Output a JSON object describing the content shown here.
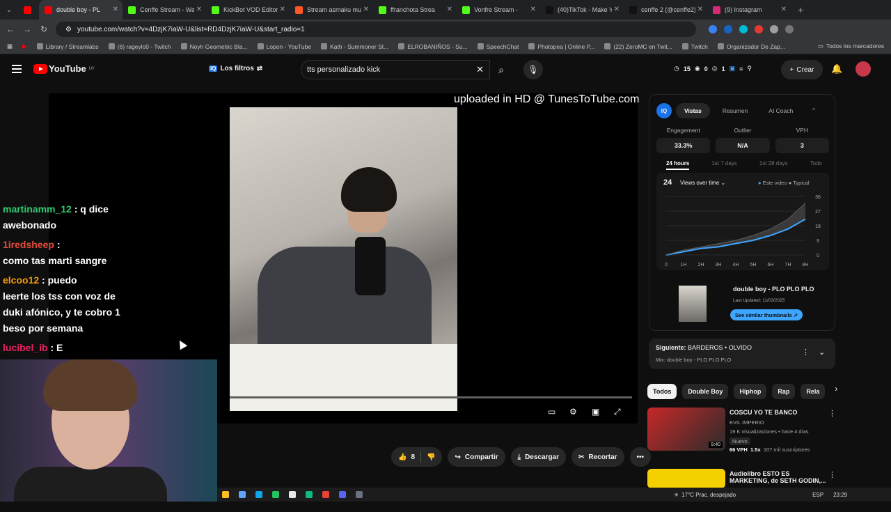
{
  "browser": {
    "tabs": [
      {
        "title": "",
        "color": "#ff0000"
      },
      {
        "title": "double boy - PL",
        "color": "#ff0000",
        "active": true
      },
      {
        "title": "Cenffe Stream - Wa",
        "color": "#53fc18"
      },
      {
        "title": "KickBot VOD Editor",
        "color": "#53fc18"
      },
      {
        "title": "Stream asmaku mu",
        "color": "#ff5722"
      },
      {
        "title": "ffranchota Strea",
        "color": "#53fc18"
      },
      {
        "title": "Vonfre Stream -",
        "color": "#53fc18"
      },
      {
        "title": "(40)TikTok - Make Y",
        "color": "#111111"
      },
      {
        "title": "cenffe 2 (@cenffe2)",
        "color": "#111111"
      },
      {
        "title": "(9) Instagram",
        "color": "#d62976"
      }
    ],
    "url": "youtube.com/watch?v=4DzjK7iaW-U&list=RD4DzjK7iaW-U&start_radio=1",
    "bookmarks": [
      "Library / Streamlabs",
      "(6) rageylo0 - Twitch",
      "Noyh Geometric Bla...",
      "Lopon - YouTube",
      "Kạth - Summoner St...",
      "ELROBANIÑOS - Su...",
      "SpeechChat",
      "Photopea | Online P...",
      "(22) ZeroMC en Twit...",
      "Twitch",
      "Organizador De Zap..."
    ],
    "all_bookmarks": "Todos los marcadores"
  },
  "youtube": {
    "logo_text": "YouTube",
    "country": "UY",
    "filters_label": "Los filtros",
    "search_value": "tts personalizado kick",
    "stats": [
      "15",
      "0",
      "1"
    ],
    "create_label": "Crear"
  },
  "video": {
    "watermark": "uploaded in HD @ TunesToTube.com",
    "likes": "8",
    "share": "Compartir",
    "download": "Descargar",
    "clip": "Recortar"
  },
  "chat": [
    {
      "user": "martinamm_12",
      "text": ": q dice",
      "user_color": "#2ecc71"
    },
    {
      "user": "",
      "text": "awebonado"
    },
    {
      "user": "1iredsheep",
      "text": ":",
      "user_color": "#e74c3c"
    },
    {
      "user": "",
      "text": "como tas marti sangre"
    },
    {
      "user": "elcoo12",
      "text": ": puedo",
      "user_color": "#f39c12"
    },
    {
      "user": "",
      "text": "leerte los tss con voz de"
    },
    {
      "user": "",
      "text": "duki afónico, y te cobro 1"
    },
    {
      "user": "",
      "text": "beso por semana"
    },
    {
      "user": "lucibel_ib",
      "text": ": E",
      "user_color": "#e91e63"
    }
  ],
  "panel": {
    "tabs": [
      "Vistas",
      "Resumen",
      "AI Coach"
    ],
    "metrics": [
      {
        "label": "Engagement",
        "value": "33.3%"
      },
      {
        "label": "Outlier",
        "value": "N/A"
      },
      {
        "label": "VPH",
        "value": "3"
      }
    ],
    "ranges": [
      "24 hours",
      "1st 7 days",
      "1st 28 days",
      "Todo"
    ],
    "chart_header": "24",
    "chart_dropdown": "Views over time",
    "legend_this": "Este video",
    "legend_typical": "Typical",
    "thumb_title": "double boy - PLO PLO PLO",
    "thumb_updated": "Last Updated: 11/03/2025",
    "thumb_button": "See similar thumbnails"
  },
  "chart_data": {
    "type": "line",
    "x": [
      "0",
      "1H",
      "2H",
      "3H",
      "4H",
      "5H",
      "6H",
      "7H",
      "8H"
    ],
    "yticks": [
      0,
      9,
      18,
      27,
      36
    ],
    "ylim": [
      0,
      36
    ],
    "series": [
      {
        "name": "Este video",
        "values": [
          0,
          2,
          4,
          5,
          7,
          9,
          12,
          16,
          22
        ]
      },
      {
        "name": "Typical",
        "values": [
          0,
          3,
          5,
          7,
          9,
          12,
          16,
          22,
          32
        ]
      }
    ]
  },
  "next": {
    "label": "Siguiente:",
    "title": "BARDEROS • OLVIDO",
    "mix": "Mix: double boy - PLO PLO PLO"
  },
  "chips": [
    "Todos",
    "Double Boy",
    "Hiphop",
    "Rap",
    "Rela"
  ],
  "recs": [
    {
      "title": "COSCU YO TE BANCO",
      "channel": "EVIL IMPERIO",
      "meta": "19 K visualizaciones • hace 4 días",
      "badge": "Nuevo",
      "vph": "66 VPH",
      "mult": "1.5x",
      "subs": "107 mil suscriptores",
      "duration": "9:40"
    },
    {
      "title": "Audiolibro ESTO ES MARKETING, de SETH GODIN,...",
      "channel": "",
      "meta": "",
      "badge": "",
      "vph": "",
      "mult": "",
      "subs": "",
      "duration": ""
    }
  ],
  "taskbar": {
    "weather": "17°C Prac. despejado",
    "lang": "ESP",
    "time": "23:29"
  }
}
